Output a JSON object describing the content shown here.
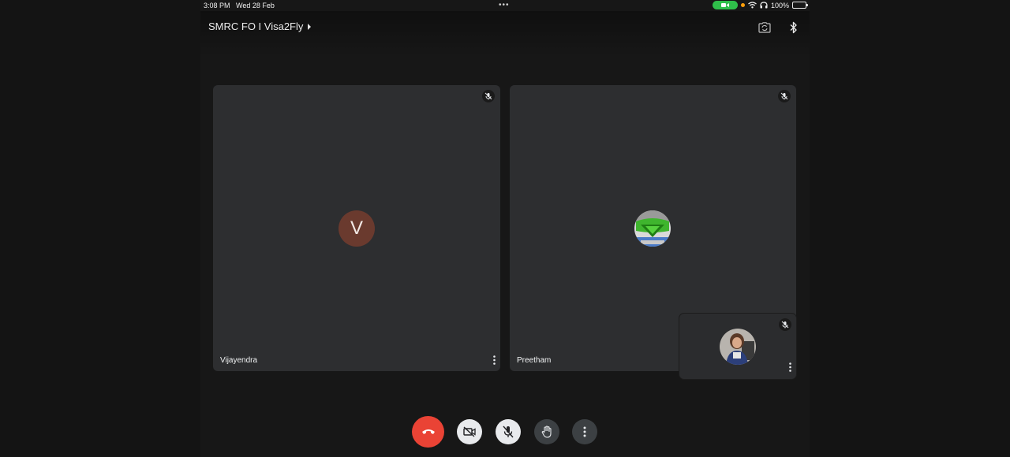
{
  "status_bar": {
    "time": "3:08 PM",
    "date": "Wed 28 Feb",
    "battery": "100%",
    "icons": [
      "camera-in-use-icon",
      "wifi-icon",
      "headphones-icon",
      "battery-icon"
    ]
  },
  "header": {
    "meeting_title": "SMRC FO I Visa2Fly",
    "icons": [
      "switch-camera-icon",
      "bluetooth-icon"
    ]
  },
  "participants": [
    {
      "name": "Vijayendra",
      "avatar_letter": "V",
      "avatar_color": "#6a3a2e",
      "muted": true
    },
    {
      "name": "Preetham",
      "avatar_letter": "",
      "muted": true
    },
    {
      "name": "",
      "muted": true,
      "self_view": true
    }
  ],
  "controls": {
    "items": [
      "end-call-icon",
      "camera-off-icon",
      "mic-off-icon",
      "raise-hand-icon",
      "more-options-icon"
    ],
    "end_call_color": "#ea4335"
  },
  "colors": {
    "background": "#171717",
    "tile": "#2d2e30",
    "accent_green": "#2fbf4a"
  }
}
